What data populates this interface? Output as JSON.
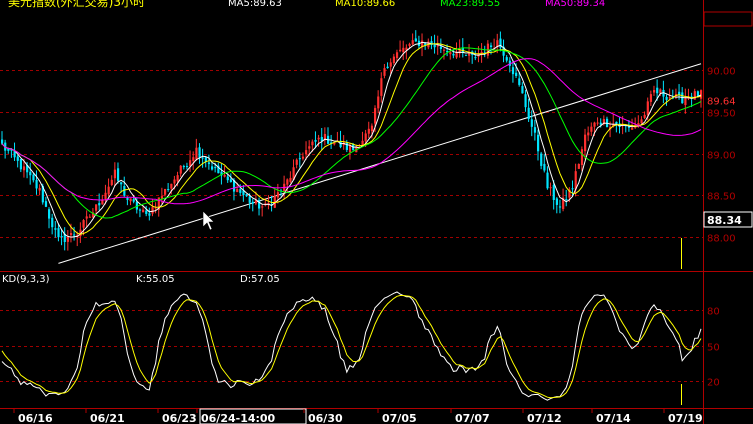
{
  "title": "美元指数(外汇交易)3小时",
  "ma_legend": [
    {
      "label": "MA5:89.63",
      "color": "#ffffff"
    },
    {
      "label": "MA10:89.66",
      "color": "#ffff00"
    },
    {
      "label": "MA23:89.55",
      "color": "#00ff00"
    },
    {
      "label": "MA50:89.34",
      "color": "#ff00ff"
    }
  ],
  "price_panel": {
    "ylim": [
      87.6,
      90.75
    ],
    "y_ticks": [
      "89.64",
      "90.00",
      "89.50",
      "89.00",
      "88.50",
      "88.00"
    ],
    "y_tick_values": [
      89.64,
      90.0,
      89.5,
      89.0,
      88.5,
      88.0
    ],
    "current_price": "88.34",
    "grid": true
  },
  "kd_panel": {
    "title": "KD(9,3,3)",
    "k_label": "K:55.05",
    "d_label": "D:57.05",
    "ylim": [
      0,
      100
    ],
    "y_ticks": [
      "80",
      "50",
      "20"
    ],
    "y_tick_values": [
      80,
      50,
      20
    ]
  },
  "x_axis": {
    "tick_labels": [
      "06/16",
      "06/21",
      "06/23",
      "06/24-14:00",
      "06/30",
      "07/05",
      "07/07",
      "07/12",
      "07/14",
      "07/19"
    ],
    "highlight_label": "06/24-14:00"
  },
  "chart_data": {
    "type": "candlestick",
    "up_color": "#ff3030",
    "down_color": "#00e5ff",
    "x_start": "06/16",
    "x_end": "07/19",
    "series": [
      {
        "name": "MA5",
        "color": "#ffffff"
      },
      {
        "name": "MA10",
        "color": "#ffff00"
      },
      {
        "name": "MA23",
        "color": "#00ff00"
      },
      {
        "name": "MA50",
        "color": "#ff00ff"
      }
    ],
    "close_anchors": [
      [
        0,
        89.1
      ],
      [
        6,
        88.85
      ],
      [
        12,
        88.55
      ],
      [
        18,
        87.95
      ],
      [
        24,
        88.05
      ],
      [
        30,
        88.35
      ],
      [
        36,
        88.75
      ],
      [
        40,
        88.45
      ],
      [
        46,
        88.25
      ],
      [
        52,
        88.55
      ],
      [
        56,
        88.75
      ],
      [
        62,
        89.05
      ],
      [
        68,
        88.8
      ],
      [
        74,
        88.6
      ],
      [
        80,
        88.4
      ],
      [
        84,
        88.35
      ],
      [
        90,
        88.6
      ],
      [
        96,
        89.0
      ],
      [
        102,
        89.2
      ],
      [
        108,
        89.1
      ],
      [
        112,
        89.05
      ],
      [
        118,
        89.3
      ],
      [
        122,
        90.05
      ],
      [
        126,
        90.2
      ],
      [
        130,
        90.3
      ],
      [
        134,
        90.35
      ],
      [
        138,
        90.3
      ],
      [
        142,
        90.25
      ],
      [
        146,
        90.2
      ],
      [
        150,
        90.15
      ],
      [
        154,
        90.25
      ],
      [
        158,
        90.35
      ],
      [
        162,
        90.1
      ],
      [
        166,
        89.7
      ],
      [
        170,
        89.2
      ],
      [
        174,
        88.6
      ],
      [
        178,
        88.35
      ],
      [
        182,
        88.6
      ],
      [
        186,
        89.2
      ],
      [
        190,
        89.4
      ],
      [
        196,
        89.35
      ],
      [
        200,
        89.3
      ],
      [
        204,
        89.4
      ],
      [
        208,
        89.75
      ],
      [
        212,
        89.7
      ],
      [
        216,
        89.65
      ],
      [
        220,
        89.7
      ]
    ],
    "trendline": {
      "from": [
        18,
        87.68
      ],
      "to": [
        223,
        90.08
      ],
      "color": "#ffffff"
    },
    "kd_series": [
      {
        "name": "K",
        "color": "#ffffff"
      },
      {
        "name": "D",
        "color": "#ffff00"
      }
    ]
  }
}
